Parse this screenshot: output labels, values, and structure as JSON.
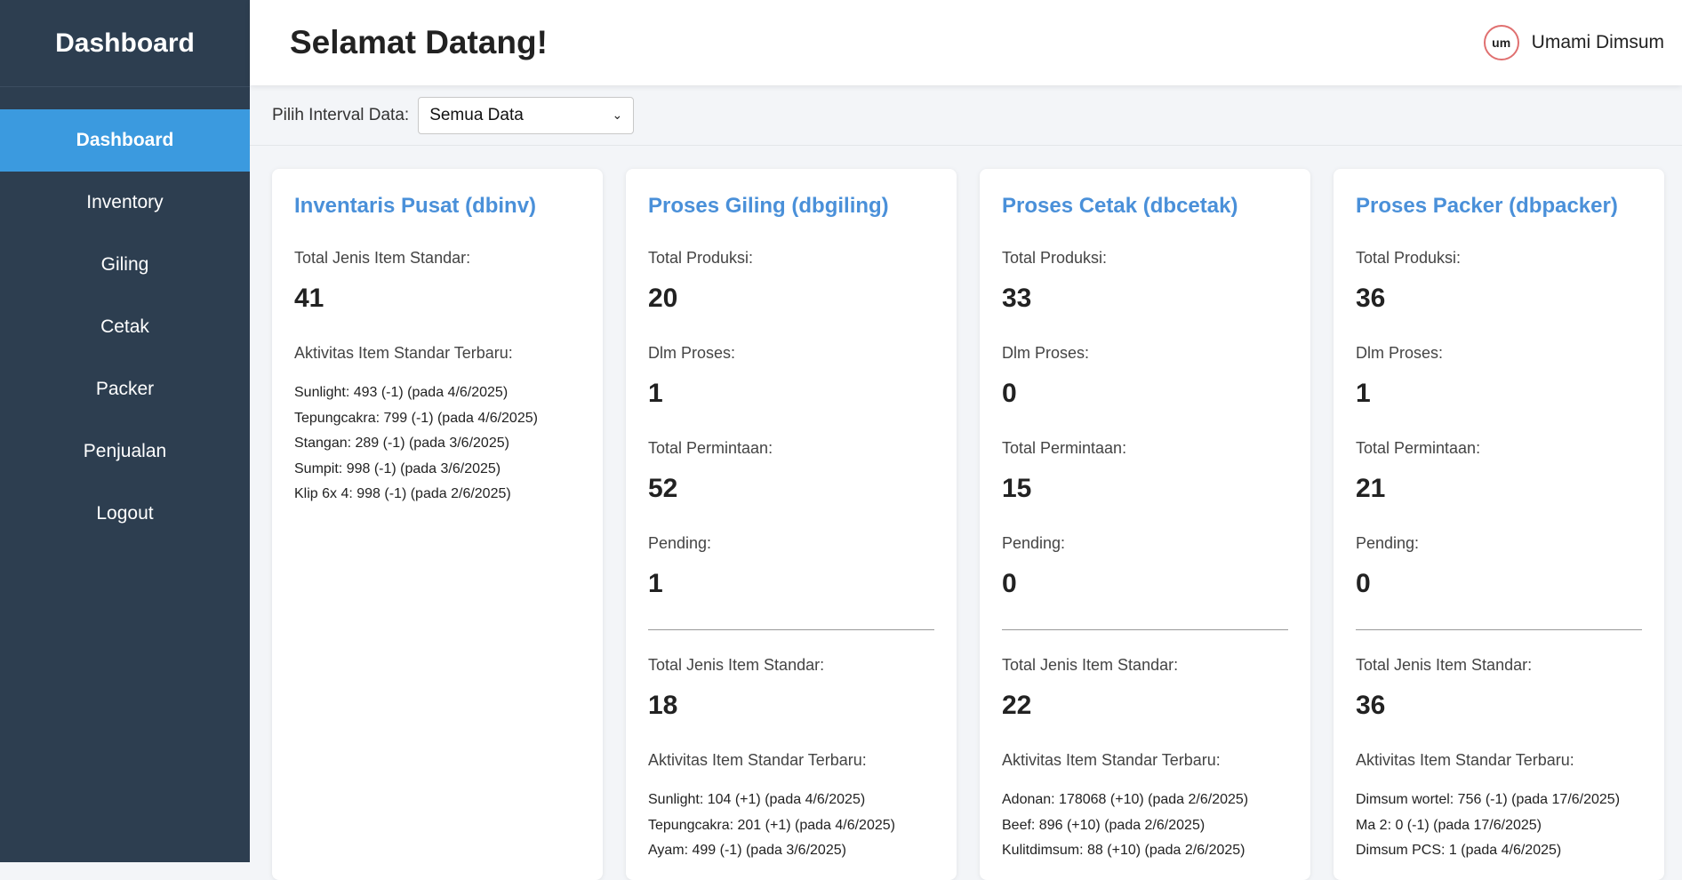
{
  "sidebar": {
    "title": "Dashboard",
    "items": [
      {
        "label": "Dashboard",
        "active": true
      },
      {
        "label": "Inventory"
      },
      {
        "label": "Giling"
      },
      {
        "label": "Cetak"
      },
      {
        "label": "Packer"
      },
      {
        "label": "Penjualan"
      },
      {
        "label": "Logout"
      }
    ]
  },
  "header": {
    "welcome": "Selamat Datang!",
    "logo_text": "um",
    "username": "Umami Dimsum"
  },
  "filter": {
    "label": "Pilih Interval Data:",
    "selected": "Semua Data"
  },
  "cards": {
    "inv": {
      "title": "Inventaris Pusat (dbinv)",
      "total_label": "Total Jenis Item Standar:",
      "total_value": "41",
      "activity_title": "Aktivitas Item Standar Terbaru:",
      "activities": [
        "Sunlight: 493 (-1) (pada 4/6/2025)",
        "Tepungcakra: 799 (-1) (pada 4/6/2025)",
        "Stangan: 289 (-1) (pada 3/6/2025)",
        "Sumpit: 998 (-1) (pada 3/6/2025)",
        "Klip 6x 4: 998 (-1) (pada 2/6/2025)"
      ]
    },
    "giling": {
      "title": "Proses Giling (dbgiling)",
      "produksi_label": "Total Produksi:",
      "produksi": "20",
      "proses_label": "Dlm Proses:",
      "proses": "1",
      "permintaan_label": "Total Permintaan:",
      "permintaan": "52",
      "pending_label": "Pending:",
      "pending": "1",
      "jenis_label": "Total Jenis Item Standar:",
      "jenis": "18",
      "activity_title": "Aktivitas Item Standar Terbaru:",
      "activities": [
        "Sunlight: 104 (+1) (pada 4/6/2025)",
        "Tepungcakra: 201 (+1) (pada 4/6/2025)",
        "Ayam: 499 (-1) (pada 3/6/2025)"
      ]
    },
    "cetak": {
      "title": "Proses Cetak (dbcetak)",
      "produksi_label": "Total Produksi:",
      "produksi": "33",
      "proses_label": "Dlm Proses:",
      "proses": "0",
      "permintaan_label": "Total Permintaan:",
      "permintaan": "15",
      "pending_label": "Pending:",
      "pending": "0",
      "jenis_label": "Total Jenis Item Standar:",
      "jenis": "22",
      "activity_title": "Aktivitas Item Standar Terbaru:",
      "activities": [
        "Adonan: 178068 (+10) (pada 2/6/2025)",
        "Beef: 896 (+10) (pada 2/6/2025)",
        "Kulitdimsum: 88 (+10) (pada 2/6/2025)"
      ]
    },
    "packer": {
      "title": "Proses Packer (dbpacker)",
      "produksi_label": "Total Produksi:",
      "produksi": "36",
      "proses_label": "Dlm Proses:",
      "proses": "1",
      "permintaan_label": "Total Permintaan:",
      "permintaan": "21",
      "pending_label": "Pending:",
      "pending": "0",
      "jenis_label": "Total Jenis Item Standar:",
      "jenis": "36",
      "activity_title": "Aktivitas Item Standar Terbaru:",
      "activities": [
        "Dimsum wortel: 756 (-1) (pada 17/6/2025)",
        "Ma 2: 0 (-1) (pada 17/6/2025)",
        "Dimsum PCS: 1 (pada 4/6/2025)"
      ]
    }
  },
  "colors": {
    "sidebar_bg": "#2d3e50",
    "active_item": "#3b9adf",
    "card_title": "#4a90d9"
  }
}
